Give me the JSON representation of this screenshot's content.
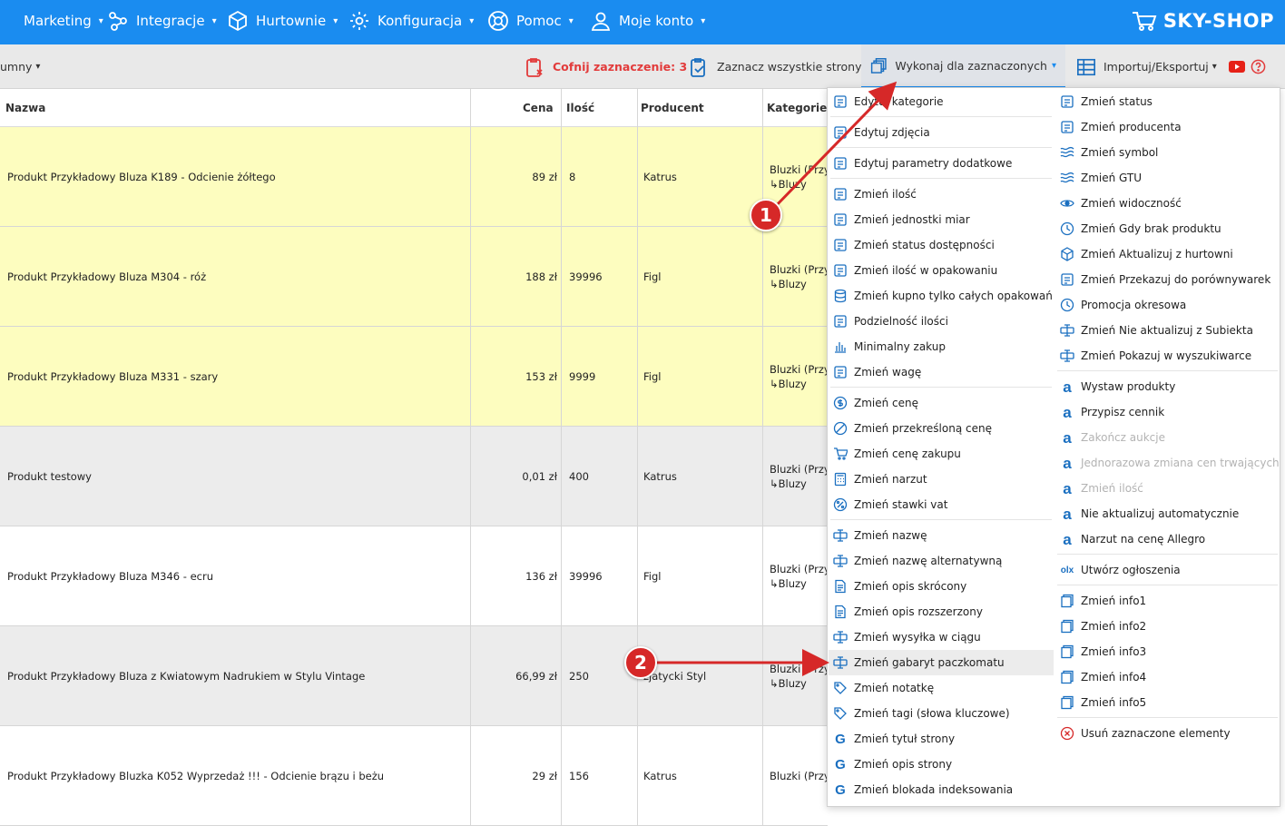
{
  "nav": {
    "items": [
      {
        "label": "Marketing",
        "icon": "megaphone-icon"
      },
      {
        "label": "Integracje",
        "icon": "share-nodes-icon"
      },
      {
        "label": "Hurtownie",
        "icon": "box-icon"
      },
      {
        "label": "Konfiguracja",
        "icon": "gear-icon"
      },
      {
        "label": "Pomoc",
        "icon": "lifebuoy-icon"
      },
      {
        "label": "Moje konto",
        "icon": "user-icon"
      }
    ],
    "logo": "SKY-SHOP"
  },
  "toolbar": {
    "columns_label": "umny",
    "undo_label": "Cofnij zaznaczenie: 3",
    "select_all_label": "Zaznacz wszystkie strony",
    "execute_label": "Wykonaj dla zaznaczonych",
    "import_export_label": "Importuj/Eksportuj"
  },
  "table": {
    "headers": {
      "name": "Nazwa",
      "price": "Cena",
      "qty": "Ilość",
      "producer": "Producent",
      "category": "Kategorie"
    },
    "rows": [
      {
        "name": "Produkt Przykładowy Bluza K189 - Odcienie żółtego",
        "price": "89 zł",
        "qty": "8",
        "producer": "Katrus",
        "cat1": "Bluzki (Przy",
        "cat2": "↳Bluzy",
        "bg": "#fdfdbf"
      },
      {
        "name": "Produkt Przykładowy Bluza M304 - róż",
        "price": "188 zł",
        "qty": "39996",
        "producer": "Figl",
        "cat1": "Bluzki (Przy",
        "cat2": "↳Bluzy",
        "bg": "#fdfdbf"
      },
      {
        "name": "Produkt Przykładowy Bluza M331 - szary",
        "price": "153 zł",
        "qty": "9999",
        "producer": "Figl",
        "cat1": "Bluzki (Przy",
        "cat2": "↳Bluzy",
        "bg": "#fdfdbf"
      },
      {
        "name": "Produkt testowy",
        "price": "0,01 zł",
        "qty": "400",
        "producer": "Katrus",
        "cat1": "Bluzki (Przy",
        "cat2": "↳Bluzy",
        "bg": "#ececec"
      },
      {
        "name": "Produkt Przykładowy Bluza M346 - ecru",
        "price": "136 zł",
        "qty": "39996",
        "producer": "Figl",
        "cat1": "Bluzki (Przy",
        "cat2": "↳Bluzy",
        "bg": "#ffffff"
      },
      {
        "name": "Produkt Przykładowy Bluza z Kwiatowym Nadrukiem w Stylu Vintage",
        "price": "66,99 zł",
        "qty": "250",
        "producer": "zjatycki Styl",
        "cat1": "Bluzki (Przy",
        "cat2": "↳Bluzy",
        "bg": "#ececec"
      },
      {
        "name": "Produkt Przykładowy Bluzka K052 Wyprzedaż !!! - Odcienie brązu i beżu",
        "price": "29 zł",
        "qty": "156",
        "producer": "Katrus",
        "cat1": "Bluzki (Przy",
        "cat2": "",
        "bg": "#ffffff"
      }
    ]
  },
  "menu": {
    "left": [
      {
        "label": "Edytuj kategorie",
        "icon": "sitemap-icon"
      },
      {
        "label": "Edytuj zdjęcia",
        "icon": "image-icon"
      },
      {
        "label": "Edytuj parametry dodatkowe",
        "icon": "list-edit-icon"
      },
      {
        "label": "Zmień ilość",
        "icon": "edit-box-icon"
      },
      {
        "label": "Zmień jednostki miar",
        "icon": "ruler-icon"
      },
      {
        "label": "Zmień status dostępności",
        "icon": "id-card-icon"
      },
      {
        "label": "Zmień ilość w opakowaniu",
        "icon": "boxes-icon"
      },
      {
        "label": "Zmień kupno tylko całych opakowań",
        "icon": "database-icon"
      },
      {
        "label": "Podzielność ilości",
        "icon": "pie-icon"
      },
      {
        "label": "Minimalny zakup",
        "icon": "bar-chart-icon"
      },
      {
        "label": "Zmień wagę",
        "icon": "bottle-icon"
      },
      {
        "label": "Zmień cenę",
        "icon": "dollar-circle-icon"
      },
      {
        "label": "Zmień przekreśloną cenę",
        "icon": "strike-price-icon"
      },
      {
        "label": "Zmień cenę zakupu",
        "icon": "cart-icon"
      },
      {
        "label": "Zmień narzut",
        "icon": "calculator-icon"
      },
      {
        "label": "Zmień stawki vat",
        "icon": "percent-icon"
      },
      {
        "label": "Zmień nazwę",
        "icon": "text-cursor-icon"
      },
      {
        "label": "Zmień nazwę alternatywną",
        "icon": "text-cursor-icon"
      },
      {
        "label": "Zmień opis skrócony",
        "icon": "document-icon"
      },
      {
        "label": "Zmień opis rozszerzony",
        "icon": "document-edit-icon"
      },
      {
        "label": "Zmień wysyłka w ciągu",
        "icon": "text-cursor-icon"
      },
      {
        "label": "Zmień gabaryt paczkomatu",
        "icon": "text-cursor-icon"
      },
      {
        "label": "Zmień notatkę",
        "icon": "note-icon"
      },
      {
        "label": "Zmień tagi (słowa kluczowe)",
        "icon": "tag-icon"
      },
      {
        "label": "Zmień tytuł strony",
        "icon": "google-icon"
      },
      {
        "label": "Zmień opis strony",
        "icon": "google-icon"
      },
      {
        "label": "Zmień blokada indeksowania",
        "icon": "google-icon"
      }
    ],
    "right": [
      {
        "label": "Zmień status",
        "icon": "status-icon"
      },
      {
        "label": "Zmień producenta",
        "icon": "factory-icon"
      },
      {
        "label": "Zmień symbol",
        "icon": "waves-icon"
      },
      {
        "label": "Zmień GTU",
        "icon": "waves-icon"
      },
      {
        "label": "Zmień widoczność",
        "icon": "eye-icon"
      },
      {
        "label": "Zmień Gdy brak produktu",
        "icon": "clock-search-icon"
      },
      {
        "label": "Zmień Aktualizuj z hurtowni",
        "icon": "cube-icon"
      },
      {
        "label": "Zmień Przekazuj do porównywarek",
        "icon": "graduation-cap-icon"
      },
      {
        "label": "Promocja okresowa",
        "icon": "clock-icon"
      },
      {
        "label": "Zmień Nie aktualizuj z Subiekta",
        "icon": "text-cursor-icon"
      },
      {
        "label": "Zmień Pokazuj w wyszukiwarce",
        "icon": "text-cursor-icon"
      },
      {
        "label": "Wystaw produkty",
        "icon": "allegro-icon"
      },
      {
        "label": "Przypisz cennik",
        "icon": "allegro-icon"
      },
      {
        "label": "Zakończ aukcje",
        "icon": "allegro-icon"
      },
      {
        "label": "Jednorazowa zmiana cen trwających aukcji",
        "icon": "allegro-icon"
      },
      {
        "label": "Zmień ilość",
        "icon": "allegro-icon"
      },
      {
        "label": "Nie aktualizuj automatycznie",
        "icon": "allegro-icon"
      },
      {
        "label": "Narzut na cenę Allegro",
        "icon": "allegro-icon"
      },
      {
        "label": "Utwórz ogłoszenia",
        "icon": "olx-icon"
      },
      {
        "label": "Zmień info1",
        "icon": "copy-icon"
      },
      {
        "label": "Zmień info2",
        "icon": "copy-icon"
      },
      {
        "label": "Zmień info3",
        "icon": "copy-icon"
      },
      {
        "label": "Zmień info4",
        "icon": "copy-icon"
      },
      {
        "label": "Zmień info5",
        "icon": "copy-icon"
      },
      {
        "label": "Usuń zaznaczone elementy",
        "icon": "delete-circle-icon"
      }
    ]
  },
  "annotations": {
    "badge1": "1",
    "badge2": "2"
  },
  "colors": {
    "brand": "#1a8cf0",
    "selected_row": "#fdfdbf",
    "annotation": "#d62828"
  }
}
